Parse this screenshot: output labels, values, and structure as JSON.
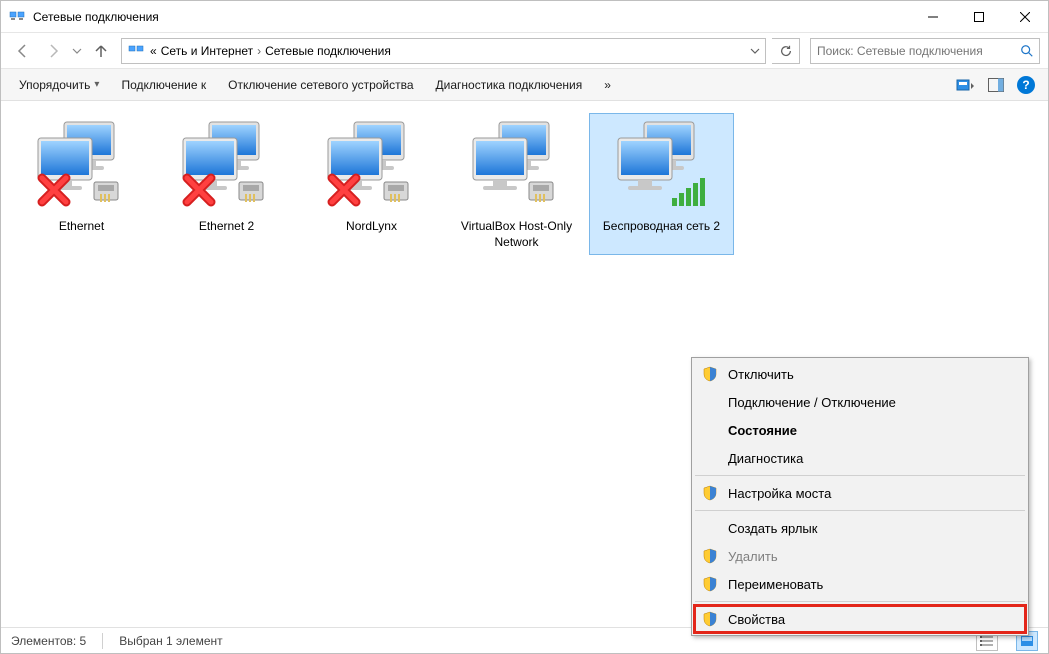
{
  "titlebar": {
    "title": "Сетевые подключения"
  },
  "breadcrumbs": {
    "root": "«",
    "level1": "Сеть и Интернет",
    "level2": "Сетевые подключения"
  },
  "search": {
    "placeholder": "Поиск: Сетевые подключения"
  },
  "toolbar": {
    "organize": "Упорядочить",
    "connect_to": "Подключение к",
    "disable_device": "Отключение сетевого устройства",
    "diagnose": "Диагностика подключения",
    "overflow": "»"
  },
  "connections": [
    {
      "name": "Ethernet",
      "disconnected": true,
      "cable": true
    },
    {
      "name": "Ethernet 2",
      "disconnected": true,
      "cable": true
    },
    {
      "name": "NordLynx",
      "disconnected": true,
      "cable": true
    },
    {
      "name": "VirtualBox Host-Only Network",
      "disconnected": false,
      "cable": true
    },
    {
      "name": "Беспроводная сеть 2",
      "disconnected": false,
      "wifi": true,
      "selected": true
    }
  ],
  "context_menu": {
    "disable": "Отключить",
    "connect_disconnect": "Подключение / Отключение",
    "status": "Состояние",
    "diagnose": "Диагностика",
    "bridge": "Настройка моста",
    "shortcut": "Создать ярлык",
    "delete": "Удалить",
    "rename": "Переименовать",
    "properties": "Свойства"
  },
  "statusbar": {
    "count": "Элементов: 5",
    "selection": "Выбран 1 элемент"
  },
  "colors": {
    "accent": "#0078d7",
    "selection": "#cde8ff",
    "highlight": "#e3261a"
  }
}
